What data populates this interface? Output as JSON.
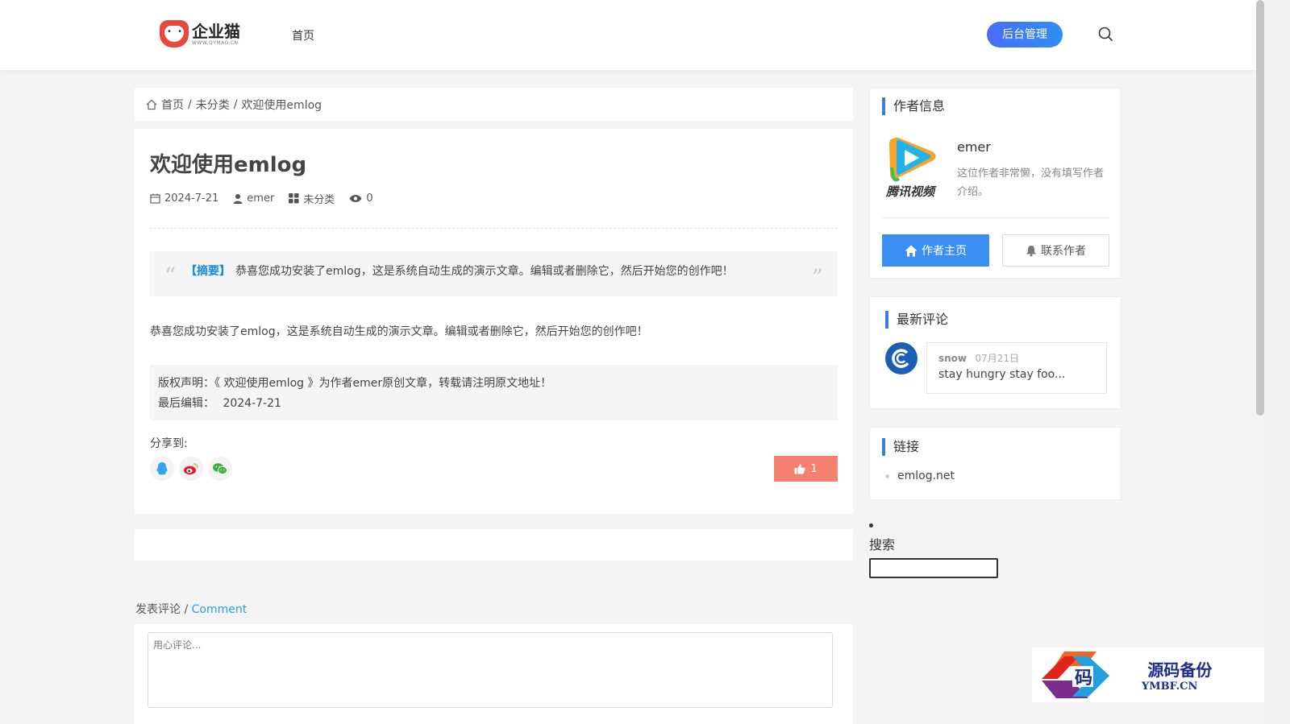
{
  "header": {
    "logo_name": "企业猫",
    "logo_sub": "WWW.QYMAO.CN",
    "nav_home": "首页",
    "admin_label": "后台管理"
  },
  "breadcrumb": {
    "home": "首页",
    "sep": "/",
    "category": "未分类",
    "current": "欢迎使用emlog"
  },
  "article": {
    "title": "欢迎使用emlog",
    "date": "2024-7-21",
    "author": "emer",
    "category": "未分类",
    "views": "0",
    "summary_tag": "【摘要】",
    "summary_text": "恭喜您成功安装了emlog，这是系统自动生成的演示文章。编辑或者删除它，然后开始您的创作吧！",
    "content": "恭喜您成功安装了emlog，这是系统自动生成的演示文章。编辑或者删除它，然后开始您的创作吧！",
    "copyright_line": "版权声明：《 欢迎使用emlog 》为作者emer原创文章，转载请注明原文地址！",
    "last_edit_label": "最后编辑：",
    "last_edit_date": "2024-7-21",
    "share_label": "分享到:",
    "likes": "1"
  },
  "comment_form": {
    "heading_cn": "发表评论",
    "heading_sep": " / ",
    "heading_en": "Comment",
    "placeholder": "用心评论..."
  },
  "sidebar": {
    "author_title": "作者信息",
    "author_avatar_text": "腾讯视频",
    "author_name": "emer",
    "author_bio": "这位作者非常懒，没有填写作者介绍。",
    "btn_home": "作者主页",
    "btn_contact": "联系作者",
    "latest_title": "最新评论",
    "latest_comment": {
      "user": "snow",
      "date": "07月21日",
      "text": "stay hungry stay foo..."
    },
    "links_title": "链接",
    "links": [
      "emlog.net"
    ],
    "search_title": "搜索"
  },
  "watermark": {
    "glyph": "码",
    "cn": "源码备份",
    "en": "YMBF.CN"
  },
  "colors": {
    "accent": "#3b8ff0",
    "admin_gradient_start": "#4a6cf7",
    "like_button": "#f58170",
    "summary_tag": "#1a8bd8",
    "comment_en": "#2aa0d8"
  }
}
